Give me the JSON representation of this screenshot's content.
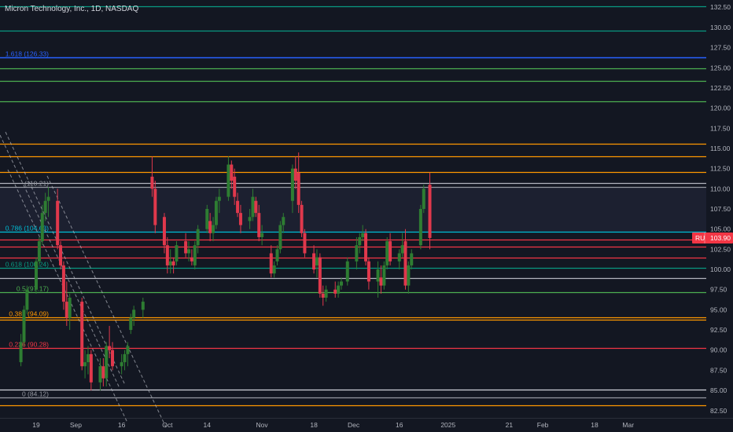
{
  "header": {
    "symbol_title": "Micron Technology, Inc., 1D, NASDAQ"
  },
  "price_tag": {
    "badge": "RU",
    "value": "103.90",
    "color": "#f23645"
  },
  "colors": {
    "background": "#131722",
    "up": "#26a69a",
    "down": "#f23645",
    "up_body": "#2e7d32",
    "down_body": "#e0384c"
  },
  "chart_data": {
    "type": "candlestick",
    "title": "",
    "ylim": [
      81.6,
      133.4
    ],
    "y_ticks": [
      82.5,
      85.0,
      87.5,
      90.0,
      92.5,
      95.0,
      97.5,
      100.0,
      102.5,
      105.0,
      107.5,
      110.0,
      112.5,
      115.0,
      117.5,
      120.0,
      122.5,
      125.0,
      127.5,
      130.0,
      132.5
    ],
    "y_tick_labels": [
      "82.50",
      "85.00",
      "87.50",
      "90.00",
      "92.50",
      "95.00",
      "97.50",
      "100.00",
      "102.50",
      "105.00",
      "107.50",
      "110.00",
      "112.50",
      "115.00",
      "117.50",
      "120.00",
      "122.50",
      "125.00",
      "127.50",
      "130.00",
      "132.50"
    ],
    "x_ticks": [
      {
        "label": "19",
        "date": "2024-08-19"
      },
      {
        "label": "Sep",
        "date": "2024-09-01"
      },
      {
        "label": "16",
        "date": "2024-09-16"
      },
      {
        "label": "Oct",
        "date": "2024-10-01"
      },
      {
        "label": "14",
        "date": "2024-10-14"
      },
      {
        "label": "Nov",
        "date": "2024-11-01"
      },
      {
        "label": "18",
        "date": "2024-11-18"
      },
      {
        "label": "Dec",
        "date": "2024-12-01"
      },
      {
        "label": "16",
        "date": "2024-12-16"
      },
      {
        "label": "2025",
        "date": "2025-01-01"
      },
      {
        "label": "21",
        "date": "2025-01-21"
      },
      {
        "label": "Feb",
        "date": "2025-02-01"
      },
      {
        "label": "18",
        "date": "2025-02-18"
      },
      {
        "label": "Mar",
        "date": "2025-03-01"
      }
    ],
    "fib_levels": [
      {
        "ratio": "0",
        "price": 84.12,
        "label": "0 (84.12)",
        "color": "#9598a1"
      },
      {
        "ratio": "0.236",
        "price": 90.28,
        "label": "0.236 (90.28)",
        "color": "#f23645"
      },
      {
        "ratio": "0.382",
        "price": 94.09,
        "label": "0.382 (94.09)",
        "color": "#ff9800"
      },
      {
        "ratio": "0.5",
        "price": 97.17,
        "label": "0.5 (97.17)",
        "color": "#4caf50"
      },
      {
        "ratio": "0.618",
        "price": 100.24,
        "label": "0.618 (100.24)",
        "color": "#089981"
      },
      {
        "ratio": "0.786",
        "price": 104.63,
        "label": "0.786 (104.63)",
        "color": "#00bcd4"
      },
      {
        "ratio": "1",
        "price": 110.21,
        "label": "(110.21)",
        "color": "#9598a1"
      },
      {
        "ratio": "1.618",
        "price": 126.33,
        "label": "1.618 (126.33)",
        "color": "#2962ff"
      }
    ],
    "horizontal_lines": [
      {
        "price": 132.6,
        "color": "#089981"
      },
      {
        "price": 129.6,
        "color": "#089981"
      },
      {
        "price": 124.9,
        "color": "#4caf50"
      },
      {
        "price": 123.4,
        "color": "#4caf50"
      },
      {
        "price": 120.8,
        "color": "#4caf50"
      },
      {
        "price": 115.6,
        "color": "#ff9800"
      },
      {
        "price": 114.0,
        "color": "#ff9800"
      },
      {
        "price": 112.1,
        "color": "#ff9800"
      },
      {
        "price": 110.7,
        "color": "#b2b5be"
      },
      {
        "price": 103.7,
        "color": "#f23645"
      },
      {
        "price": 102.8,
        "color": "#f23645"
      },
      {
        "price": 101.5,
        "color": "#f23645"
      },
      {
        "price": 98.9,
        "color": "#b2b5be"
      },
      {
        "price": 93.8,
        "color": "#ff9800"
      },
      {
        "price": 85.1,
        "color": "#d1d4dc"
      },
      {
        "price": 83.2,
        "color": "#ff9800"
      }
    ],
    "candles": [
      [
        "2024-08-14",
        88.5,
        92.0,
        88.0,
        91.0
      ],
      [
        "2024-08-15",
        91.0,
        95.5,
        90.5,
        95.0
      ],
      [
        "2024-08-16",
        95.0,
        98.0,
        94.5,
        97.5
      ],
      [
        "2024-08-19",
        97.5,
        101.5,
        97.0,
        101.0
      ],
      [
        "2024-08-20",
        101.0,
        104.0,
        100.5,
        103.5
      ],
      [
        "2024-08-21",
        103.5,
        108.0,
        103.0,
        107.0
      ],
      [
        "2024-08-22",
        107.0,
        109.5,
        106.0,
        108.5
      ],
      [
        "2024-08-23",
        108.5,
        110.2,
        106.5,
        109.0
      ],
      [
        "2024-08-26",
        108.5,
        110.0,
        102.5,
        103.0
      ],
      [
        "2024-08-27",
        103.0,
        103.5,
        100.0,
        100.5
      ],
      [
        "2024-08-28",
        100.5,
        101.0,
        95.0,
        96.0
      ],
      [
        "2024-08-29",
        96.0,
        98.5,
        93.0,
        94.0
      ],
      [
        "2024-08-30",
        94.0,
        97.0,
        92.5,
        96.5
      ],
      [
        "2024-09-03",
        96.0,
        96.5,
        87.5,
        88.0
      ],
      [
        "2024-09-04",
        88.0,
        90.0,
        86.5,
        88.5
      ],
      [
        "2024-09-05",
        88.5,
        90.5,
        87.0,
        89.5
      ],
      [
        "2024-09-06",
        89.5,
        90.0,
        85.0,
        86.0
      ],
      [
        "2024-09-09",
        86.0,
        89.0,
        85.0,
        88.0
      ],
      [
        "2024-09-10",
        88.0,
        89.0,
        85.5,
        86.5
      ],
      [
        "2024-09-11",
        86.5,
        91.0,
        85.5,
        90.5
      ],
      [
        "2024-09-12",
        90.5,
        93.0,
        89.0,
        90.0
      ],
      [
        "2024-09-13",
        90.0,
        91.0,
        87.5,
        88.0
      ],
      [
        "2024-09-16",
        88.0,
        89.5,
        87.0,
        88.5
      ],
      [
        "2024-09-17",
        88.5,
        90.0,
        87.5,
        89.5
      ],
      [
        "2024-09-18",
        89.5,
        91.0,
        88.0,
        90.5
      ],
      [
        "2024-09-19",
        92.5,
        94.5,
        92.0,
        94.0
      ],
      [
        "2024-09-20",
        94.0,
        95.5,
        93.0,
        95.0
      ],
      [
        "2024-09-23",
        95.0,
        96.5,
        94.0,
        96.0
      ],
      [
        "2024-09-26",
        111.5,
        114.0,
        109.0,
        110.0
      ],
      [
        "2024-09-27",
        110.0,
        111.0,
        104.5,
        105.5
      ],
      [
        "2024-09-30",
        106.5,
        107.0,
        102.0,
        103.0
      ],
      [
        "2024-10-01",
        103.0,
        104.0,
        99.5,
        100.5
      ],
      [
        "2024-10-02",
        100.5,
        102.5,
        99.5,
        101.0
      ],
      [
        "2024-10-03",
        101.0,
        101.5,
        99.5,
        100.5
      ],
      [
        "2024-10-04",
        101.0,
        103.5,
        100.5,
        103.0
      ],
      [
        "2024-10-07",
        103.5,
        104.5,
        101.5,
        102.0
      ],
      [
        "2024-10-08",
        102.0,
        103.5,
        101.0,
        102.5
      ],
      [
        "2024-10-09",
        101.5,
        102.5,
        100.5,
        101.0
      ],
      [
        "2024-10-10",
        100.5,
        103.5,
        100.0,
        103.0
      ],
      [
        "2024-10-11",
        103.0,
        105.5,
        102.0,
        105.0
      ],
      [
        "2024-10-14",
        105.0,
        108.0,
        104.5,
        107.5
      ],
      [
        "2024-10-15",
        106.0,
        107.0,
        103.5,
        104.5
      ],
      [
        "2024-10-16",
        104.5,
        106.5,
        103.5,
        105.5
      ],
      [
        "2024-10-17",
        105.5,
        109.0,
        105.0,
        108.5
      ],
      [
        "2024-10-18",
        108.5,
        110.0,
        107.0,
        109.0
      ],
      [
        "2024-10-21",
        109.0,
        114.0,
        108.5,
        113.0
      ],
      [
        "2024-10-22",
        113.0,
        113.5,
        110.0,
        111.0
      ],
      [
        "2024-10-23",
        111.5,
        112.5,
        108.0,
        109.0
      ],
      [
        "2024-10-24",
        108.5,
        109.5,
        106.5,
        107.0
      ],
      [
        "2024-10-25",
        107.0,
        108.0,
        104.5,
        105.5
      ],
      [
        "2024-10-28",
        106.0,
        107.5,
        105.0,
        106.5
      ],
      [
        "2024-10-29",
        106.5,
        110.0,
        106.0,
        109.0
      ],
      [
        "2024-10-30",
        108.5,
        109.0,
        106.5,
        107.0
      ],
      [
        "2024-10-31",
        107.0,
        108.0,
        103.5,
        104.0
      ],
      [
        "2024-11-01",
        104.0,
        105.5,
        103.0,
        104.5
      ],
      [
        "2024-11-04",
        102.0,
        103.0,
        99.0,
        99.5
      ],
      [
        "2024-11-05",
        99.5,
        101.0,
        99.0,
        100.5
      ],
      [
        "2024-11-06",
        101.0,
        103.0,
        100.5,
        102.5
      ],
      [
        "2024-11-07",
        102.5,
        106.0,
        102.0,
        105.5
      ],
      [
        "2024-11-08",
        105.5,
        107.0,
        104.5,
        106.5
      ],
      [
        "2024-11-11",
        108.5,
        113.0,
        107.0,
        112.5
      ],
      [
        "2024-11-12",
        112.5,
        114.0,
        110.0,
        111.0
      ],
      [
        "2024-11-13",
        112.0,
        114.5,
        107.0,
        108.0
      ],
      [
        "2024-11-14",
        108.0,
        108.5,
        104.0,
        104.5
      ],
      [
        "2024-11-15",
        104.5,
        105.0,
        101.5,
        102.0
      ],
      [
        "2024-11-18",
        102.0,
        103.0,
        99.5,
        100.0
      ],
      [
        "2024-11-19",
        100.5,
        102.5,
        99.0,
        101.5
      ],
      [
        "2024-11-20",
        101.5,
        102.0,
        96.5,
        97.0
      ],
      [
        "2024-11-21",
        97.0,
        98.0,
        95.5,
        96.5
      ],
      [
        "2024-11-22",
        96.5,
        98.0,
        96.0,
        97.5
      ],
      [
        "2024-11-25",
        97.5,
        98.5,
        96.5,
        97.0
      ],
      [
        "2024-11-26",
        97.0,
        98.5,
        96.5,
        98.0
      ],
      [
        "2024-11-27",
        98.0,
        99.0,
        97.5,
        98.5
      ],
      [
        "2024-11-29",
        98.5,
        101.5,
        98.0,
        101.0
      ],
      [
        "2024-12-02",
        101.0,
        104.0,
        100.0,
        103.0
      ],
      [
        "2024-12-03",
        103.0,
        104.5,
        102.0,
        104.0
      ],
      [
        "2024-12-04",
        104.0,
        105.5,
        103.5,
        104.5
      ],
      [
        "2024-12-05",
        104.5,
        105.0,
        100.5,
        101.0
      ],
      [
        "2024-12-06",
        101.0,
        101.5,
        97.5,
        98.5
      ],
      [
        "2024-12-09",
        98.5,
        101.0,
        96.5,
        100.0
      ],
      [
        "2024-12-10",
        99.0,
        100.5,
        97.0,
        98.0
      ],
      [
        "2024-12-11",
        98.0,
        101.0,
        97.5,
        100.5
      ],
      [
        "2024-12-12",
        100.5,
        104.0,
        100.0,
        103.5
      ],
      [
        "2024-12-13",
        103.5,
        104.5,
        100.5,
        101.0
      ],
      [
        "2024-12-16",
        101.0,
        102.5,
        100.0,
        102.0
      ],
      [
        "2024-12-17",
        102.0,
        104.5,
        101.5,
        103.0
      ],
      [
        "2024-12-18",
        103.5,
        105.0,
        97.5,
        98.0
      ],
      [
        "2024-12-19",
        98.0,
        101.0,
        97.0,
        100.5
      ],
      [
        "2024-12-20",
        100.5,
        102.5,
        100.0,
        102.0
      ],
      [
        "2024-12-23",
        103.0,
        108.0,
        102.5,
        107.5
      ],
      [
        "2024-12-24",
        107.5,
        110.5,
        107.0,
        110.0
      ],
      [
        "2024-12-26",
        110.5,
        112.0,
        102.5,
        103.9
      ]
    ]
  }
}
